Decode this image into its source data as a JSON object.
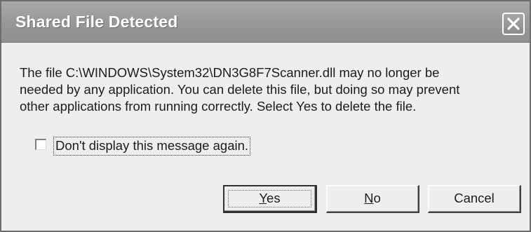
{
  "window": {
    "title": "Shared File Detected"
  },
  "titlebar": {
    "close_icon": "close-x-icon"
  },
  "message": {
    "line1": "The file C:\\WINDOWS\\System32\\DN3G8F7Scanner.dll may no longer be",
    "line2": "needed by any application. You can delete this file, but doing so may prevent",
    "line3": "other applications from running correctly.  Select Yes to delete the file."
  },
  "checkbox": {
    "label": "Don't display this message again.",
    "checked": false
  },
  "buttons": {
    "yes_mnemonic": "Y",
    "yes_rest": "es",
    "no_mnemonic": "N",
    "no_rest": "o",
    "cancel_label": "Cancel"
  }
}
